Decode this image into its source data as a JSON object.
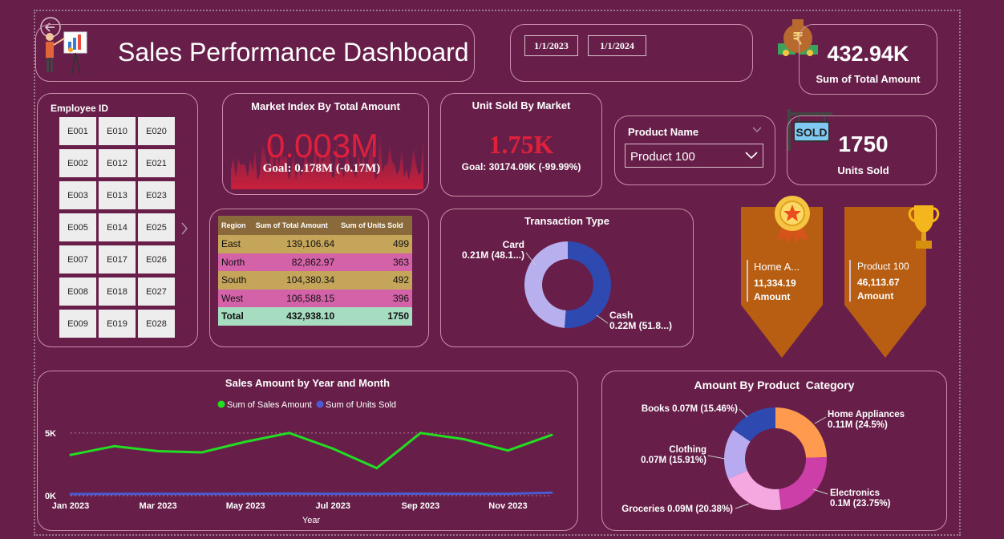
{
  "header": {
    "title": "Sales Performance Dashboard"
  },
  "date_range": {
    "start": "1/1/2023",
    "end": "1/1/2024"
  },
  "kpi_total": {
    "value": "432.94K",
    "label": "Sum of Total Amount"
  },
  "kpi_units": {
    "value": "1750",
    "label": "Units Sold",
    "sign_text": "SOLD"
  },
  "employee_slicer": {
    "title": "Employee ID",
    "ids": [
      "E001",
      "E010",
      "E020",
      "E002",
      "E012",
      "E021",
      "E003",
      "E013",
      "E023",
      "E005",
      "E014",
      "E025",
      "E007",
      "E017",
      "E026",
      "E008",
      "E018",
      "E027",
      "E009",
      "E019",
      "E028"
    ]
  },
  "market_index": {
    "title": "Market Index By Total Amount",
    "value": "0.003M",
    "goal": "Goal: 0.178M (-0.17M)"
  },
  "unit_sold_market": {
    "title": "Unit Sold By Market",
    "value": "1.75K",
    "goal": "Goal: 30174.09K (-99.99%)"
  },
  "product_filter": {
    "label": "Product Name",
    "selected": "Product 100"
  },
  "region_table": {
    "headers": [
      "Region",
      "Sum of Total Amount",
      "Sum of Units Sold"
    ],
    "rows": [
      {
        "region": "East",
        "amount": "139,106.64",
        "units": "499",
        "color": "#c4a55a"
      },
      {
        "region": "North",
        "amount": "82,862.97",
        "units": "363",
        "color": "#d462a8"
      },
      {
        "region": "South",
        "amount": "104,380.34",
        "units": "492",
        "color": "#c4a55a"
      },
      {
        "region": "West",
        "amount": "106,588.15",
        "units": "396",
        "color": "#d462a8"
      }
    ],
    "total": {
      "region": "Total",
      "amount": "432,938.10",
      "units": "1750",
      "color": "#a6dcc0"
    }
  },
  "top_category": {
    "name": "Home A...",
    "value": "11,334.19",
    "metric": "Amount"
  },
  "top_product": {
    "name": "Product 100",
    "value": "46,113.67",
    "metric": "Amount"
  },
  "chart_data": [
    {
      "type": "pie",
      "title": "Transaction Type",
      "slices": [
        {
          "label": "Card",
          "value": 0.21,
          "value_label": "0.21M (48.1...)",
          "color": "#b8b0ee"
        },
        {
          "label": "Cash",
          "value": 0.22,
          "value_label": "0.22M (51.8...)",
          "color": "#2e4ab0"
        }
      ]
    },
    {
      "type": "line",
      "title": "Sales Amount by Year and Month",
      "xlabel": "Year",
      "x": [
        "Jan 2023",
        "Feb 2023",
        "Mar 2023",
        "Apr 2023",
        "May 2023",
        "Jun 2023",
        "Jul 2023",
        "Aug 2023",
        "Sep 2023",
        "Oct 2023",
        "Nov 2023",
        "Dec 2023"
      ],
      "tick_labels": [
        "Jan 2023",
        "",
        "Mar 2023",
        "",
        "May 2023",
        "",
        "Jul 2023",
        "",
        "Sep 2023",
        "",
        "Nov 2023",
        ""
      ],
      "y_ticks": [
        "0K",
        "5K"
      ],
      "ylim": [
        0,
        5500
      ],
      "legend_position": "top",
      "series": [
        {
          "name": "Sum of Sales Amount",
          "color": "#22dd22",
          "values": [
            3250,
            3950,
            3550,
            3450,
            4300,
            5000,
            3750,
            2200,
            5000,
            4500,
            3600,
            4850
          ]
        },
        {
          "name": "Sum of Units Sold",
          "color": "#4a5ad0",
          "values": [
            130,
            145,
            155,
            140,
            150,
            165,
            155,
            150,
            160,
            150,
            150,
            240
          ]
        }
      ]
    },
    {
      "type": "pie",
      "title": "Amount By Product  Category",
      "slices": [
        {
          "label": "Home Appliances",
          "value": 24.5,
          "value_label": "0.11M (24.5%)",
          "color": "#ff9a4e"
        },
        {
          "label": "Electronics",
          "value": 23.75,
          "value_label": "0.1M (23.75%)",
          "color": "#cc3fa8"
        },
        {
          "label": "Groceries",
          "value": 20.38,
          "value_label": "Groceries 0.09M (20.38%)",
          "color": "#f5a8e0"
        },
        {
          "label": "Clothing",
          "value": 15.91,
          "value_label": "0.07M (15.91%)",
          "color": "#b8aaf0"
        },
        {
          "label": "Books",
          "value": 15.46,
          "value_label": "Books 0.07M (15.46%)",
          "color": "#2e4ab0"
        }
      ]
    }
  ]
}
